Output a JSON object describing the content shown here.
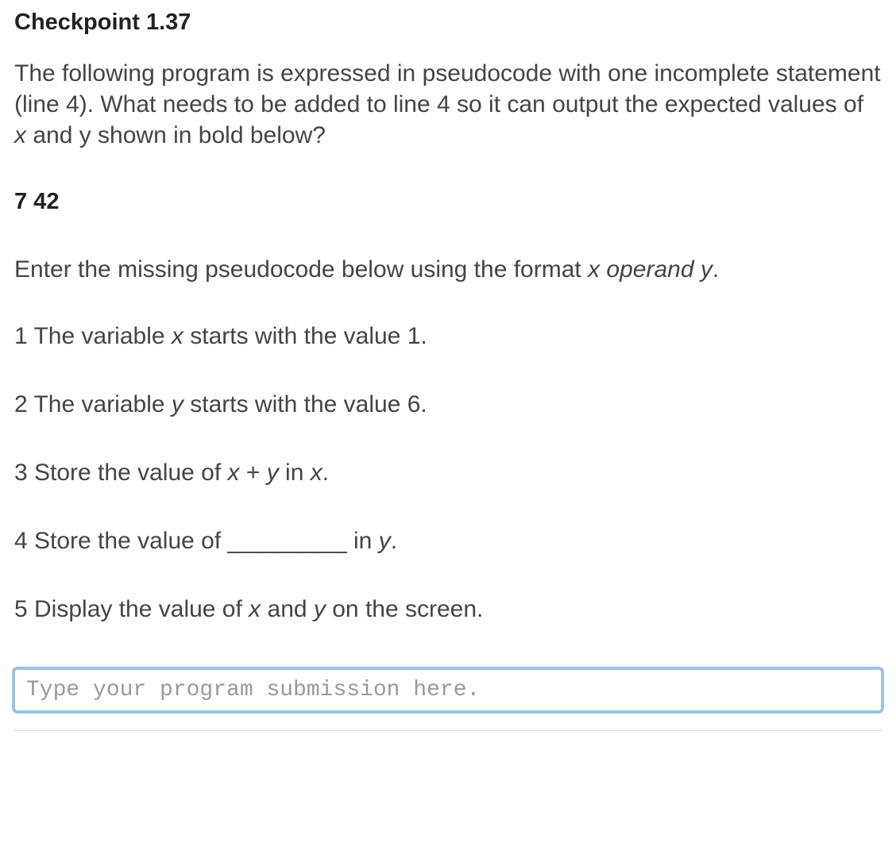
{
  "checkpoint": {
    "title": "Checkpoint 1.37"
  },
  "intro": {
    "part1": "The following program is expressed in pseudocode with one incomplete statement (line 4). What needs to be added to line 4 so it can output the expected values of ",
    "var_x": "x",
    "part2": " and y shown in bold below?"
  },
  "expected": "7  42",
  "instruction": {
    "part1": "Enter the missing pseudocode below using the format ",
    "format_italic": "x operand y",
    "part2": "."
  },
  "lines": {
    "l1": {
      "pre": "1 The variable ",
      "var": "x",
      "post": " starts with the value 1."
    },
    "l2": {
      "pre": "2 The variable ",
      "var": "y",
      "post": " starts with the value 6."
    },
    "l3": {
      "pre": "3 Store the value of ",
      "exprA": "x",
      "mid": " + ",
      "exprB": "y",
      "mid2": " in ",
      "target": "x",
      "post": "."
    },
    "l4": {
      "pre": "4 Store the value of _________ in ",
      "target": "y",
      "post": "."
    },
    "l5": {
      "pre": "5 Display the value of ",
      "varA": "x",
      "mid": " and ",
      "varB": "y",
      "post": " on the screen."
    }
  },
  "input": {
    "placeholder": "Type your program submission here."
  }
}
